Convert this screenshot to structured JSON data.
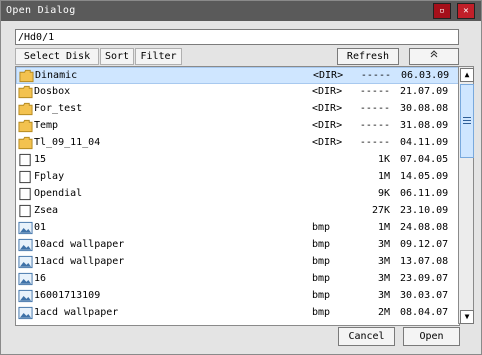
{
  "window": {
    "title": "Open Dialog",
    "restore_icon": "restore-icon",
    "close_icon": "close-icon"
  },
  "toolbar": {
    "path_value": "/Hd0/1",
    "select_disk_label": "Select Disk",
    "sort_label": "Sort",
    "filter_label": "Filter",
    "refresh_label": "Refresh",
    "up_icon": "double-chevron-up-icon"
  },
  "files": [
    {
      "name": "Dinamic",
      "type": "<DIR>",
      "size": "-----",
      "date": "06.03.09",
      "icon": "folder-icon",
      "selected": true
    },
    {
      "name": "Dosbox",
      "type": "<DIR>",
      "size": "-----",
      "date": "21.07.09",
      "icon": "folder-icon"
    },
    {
      "name": "For_test",
      "type": "<DIR>",
      "size": "-----",
      "date": "30.08.08",
      "icon": "folder-icon"
    },
    {
      "name": "Temp",
      "type": "<DIR>",
      "size": "-----",
      "date": "31.08.09",
      "icon": "folder-icon"
    },
    {
      "name": "Tl_09_11_04",
      "type": "<DIR>",
      "size": "-----",
      "date": "04.11.09",
      "icon": "folder-icon"
    },
    {
      "name": "15",
      "type": "",
      "size": "1K",
      "date": "07.04.05",
      "icon": "file-icon"
    },
    {
      "name": "Fplay",
      "type": "",
      "size": "1M",
      "date": "14.05.09",
      "icon": "file-icon"
    },
    {
      "name": "Opendial",
      "type": "",
      "size": "9K",
      "date": "06.11.09",
      "icon": "file-icon"
    },
    {
      "name": "Zsea",
      "type": "",
      "size": "27K",
      "date": "23.10.09",
      "icon": "file-icon"
    },
    {
      "name": "01",
      "type": "bmp",
      "size": "1M",
      "date": "24.08.08",
      "icon": "image-icon"
    },
    {
      "name": "10acd wallpaper",
      "type": "bmp",
      "size": "3M",
      "date": "09.12.07",
      "icon": "image-icon"
    },
    {
      "name": "11acd wallpaper",
      "type": "bmp",
      "size": "3M",
      "date": "13.07.08",
      "icon": "image-icon"
    },
    {
      "name": "16",
      "type": "bmp",
      "size": "3M",
      "date": "23.09.07",
      "icon": "image-icon"
    },
    {
      "name": "16001713109",
      "type": "bmp",
      "size": "3M",
      "date": "30.03.07",
      "icon": "image-icon"
    },
    {
      "name": "1acd wallpaper",
      "type": "bmp",
      "size": "2M",
      "date": "08.04.07",
      "icon": "image-icon"
    }
  ],
  "scrollbar": {
    "up_icon": "scroll-up-arrow-icon",
    "down_icon": "scroll-down-arrow-icon",
    "thumb_icon": "grip-lines-icon"
  },
  "footer": {
    "cancel_label": "Cancel",
    "open_label": "Open"
  }
}
